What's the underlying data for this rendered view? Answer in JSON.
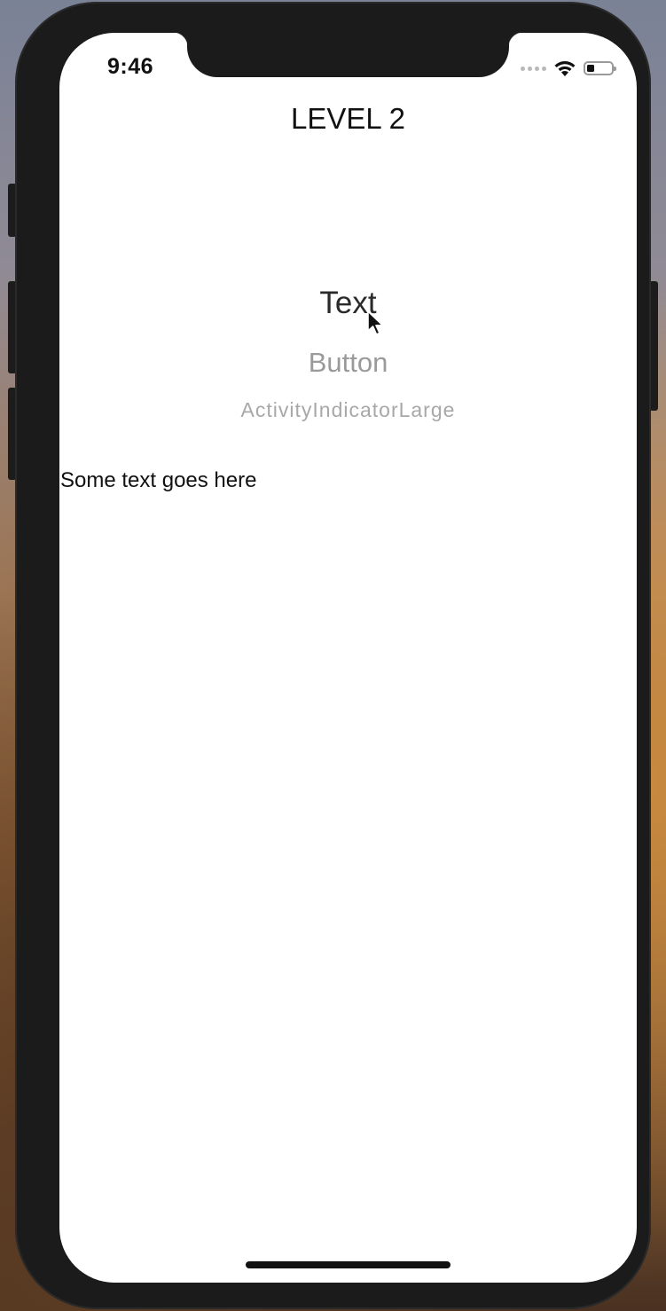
{
  "status_bar": {
    "time": "9:46",
    "battery_level": 0.3
  },
  "screen": {
    "title": "LEVEL 2",
    "text_label": "Text",
    "button_label": "Button",
    "activity_indicator_label": "ActivityIndicatorLarge",
    "body_text": "Some text goes here"
  },
  "icons": {
    "signal": "signal-dots-icon",
    "wifi": "wifi-icon",
    "battery": "battery-icon",
    "cursor": "mouse-pointer-icon"
  },
  "colors": {
    "screen_background": "#ffffff",
    "device_frame": "#1b1b1b",
    "button_text": "#9a9a9a"
  }
}
